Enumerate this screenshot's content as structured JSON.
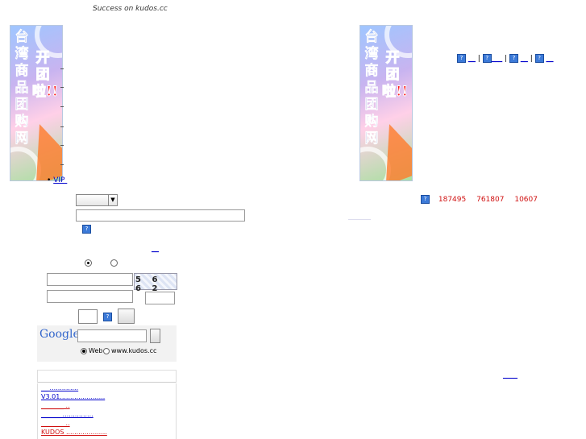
{
  "header": {
    "success_text": "Success on kudos.cc"
  },
  "banner": {
    "left_text": "台湾商品团购网",
    "right_text": "开团啦!!"
  },
  "left": {
    "vip_label": "VIP",
    "vip_underline": " ",
    "link_under_help": "__",
    "radio_1_selected": true,
    "radio_2_selected": false,
    "captcha_text": "5 6 6 2",
    "google": {
      "logo_text": "Google",
      "web_label": "Web",
      "site_label": "www.kudos.cc",
      "selected": "web"
    },
    "news_list": [
      {
        "text": "__  ..............",
        "color": "#0000cc"
      },
      {
        "text": "V3.01......................",
        "color": "#0000cc"
      },
      {
        "text": "_______  ..",
        "color": "#d01010"
      },
      {
        "text": "______  ...............",
        "color": "#0000cc"
      },
      {
        "text": "_______  ..",
        "color": "#d01010"
      },
      {
        "text": "KUDOS    ....................",
        "color": "#d01010"
      }
    ]
  },
  "right": {
    "top_links": [
      "__",
      "___",
      "__",
      "__"
    ],
    "stats": [
      "187495",
      "761807",
      "10607"
    ],
    "bottom_links": "____"
  }
}
